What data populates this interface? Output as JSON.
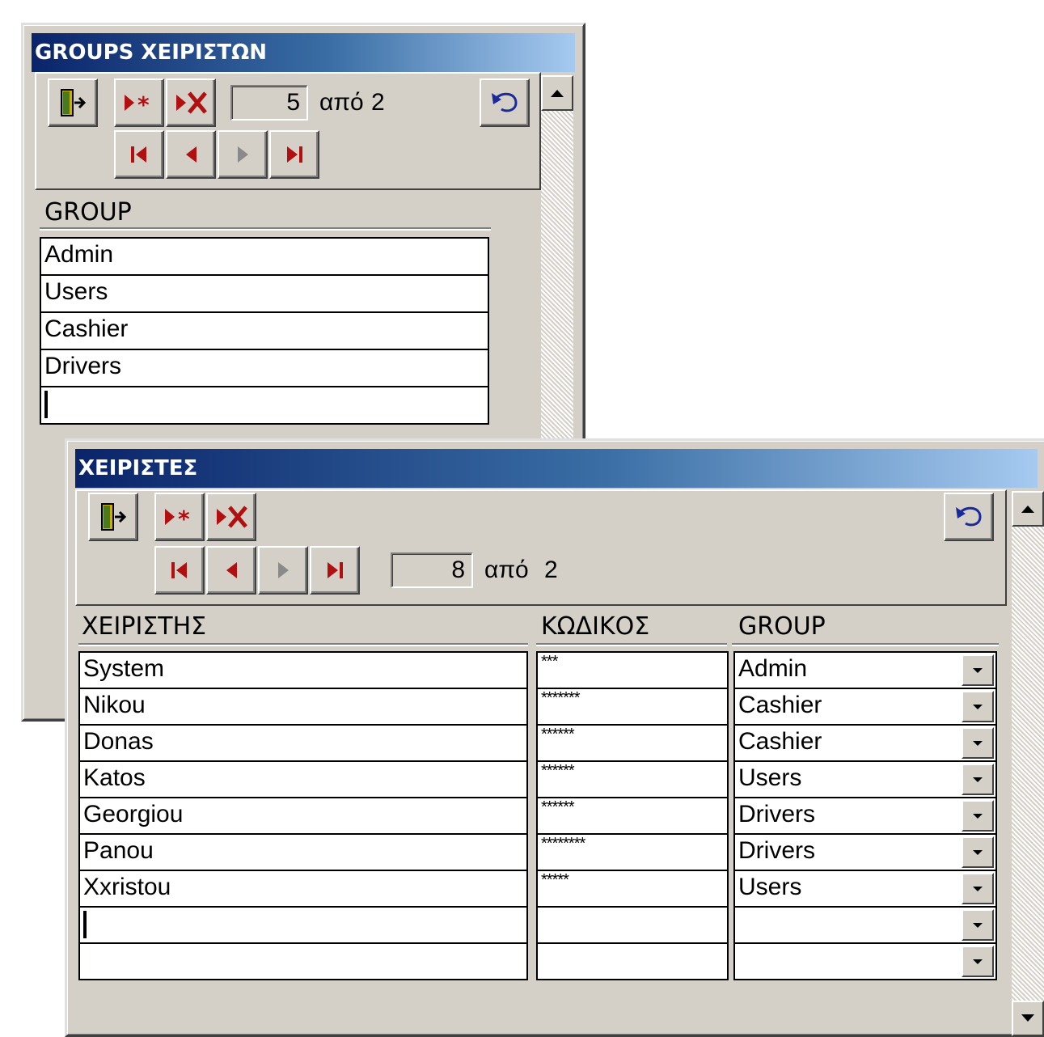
{
  "groups_window": {
    "title": "GROUPS ΧΕΙΡΙΣΤΩΝ",
    "record_counter": "5",
    "of_label": "από",
    "total": "2",
    "column_header": "GROUP",
    "rows": [
      "Admin",
      "Users",
      "Cashier",
      "Drivers",
      ""
    ]
  },
  "operators_window": {
    "title": "ΧΕΙΡΙΣΤΕΣ",
    "record_counter": "8",
    "of_label": "από",
    "total": "2",
    "headers": {
      "operator": "ΧΕΙΡΙΣΤΗΣ",
      "code": "ΚΩΔΙΚΟΣ",
      "group": "GROUP"
    },
    "rows": [
      {
        "operator": "System",
        "code": "***",
        "group": "Admin"
      },
      {
        "operator": "Nikou",
        "code": "*******",
        "group": "Cashier"
      },
      {
        "operator": "Donas",
        "code": "******",
        "group": "Cashier"
      },
      {
        "operator": "Katos",
        "code": "******",
        "group": "Users"
      },
      {
        "operator": "Georgiou",
        "code": "******",
        "group": "Drivers"
      },
      {
        "operator": "Panou",
        "code": "********",
        "group": "Drivers"
      },
      {
        "operator": "Xxristou",
        "code": "*****",
        "group": "Users"
      },
      {
        "operator": "",
        "code": "",
        "group": ""
      },
      {
        "operator": "",
        "code": "",
        "group": ""
      }
    ]
  },
  "icons": {
    "exit": "exit-door-icon",
    "new_record": "new-record-icon",
    "delete_record": "delete-record-icon",
    "undo": "undo-icon",
    "first": "first-record-icon",
    "prev": "previous-record-icon",
    "next": "next-record-icon",
    "last": "last-record-icon"
  },
  "colors": {
    "title_start": "#0a246a",
    "title_end": "#a6caf0",
    "face": "#d4d0c8",
    "nav_arrow": "#b01010"
  }
}
